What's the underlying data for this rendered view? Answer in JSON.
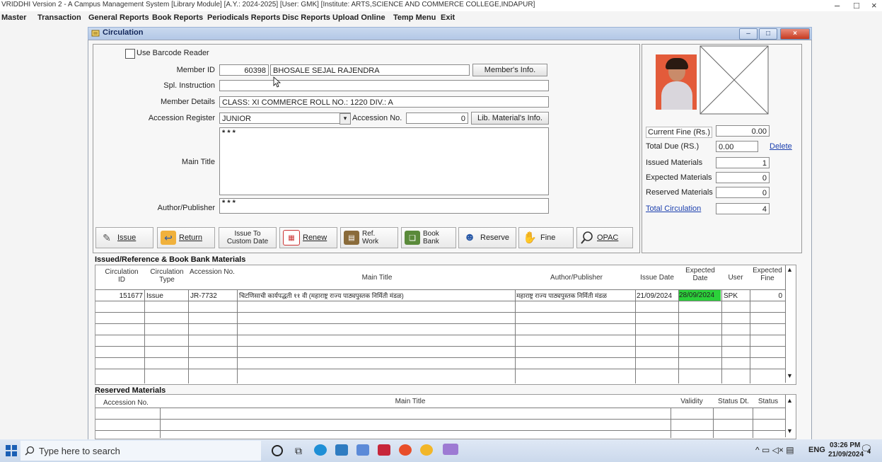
{
  "app": {
    "title": "VRIDDHI Version 2 - A Campus Management System [Library Module] [A.Y.: 2024-2025] [User: GMK] [Institute: ARTS,SCIENCE AND COMMERCE COLLEGE,INDAPUR]",
    "window_controls": [
      "–",
      "□",
      "×"
    ]
  },
  "menu": [
    "Master",
    "Transaction",
    "General Reports",
    "Book Reports",
    "Periodicals Reports",
    "Disc Reports",
    "Upload Online",
    "Temp Menu",
    "Exit"
  ],
  "window": {
    "title": "Circulation",
    "controls": [
      "–",
      "□",
      "×"
    ]
  },
  "form": {
    "barcode_label": "Use Barcode Reader",
    "member_id_label": "Member ID",
    "member_id": "60398",
    "member_name": "BHOSALE SEJAL RAJENDRA",
    "members_info_btn": "Member's Info.",
    "spl_instruction_label": "Spl. Instruction",
    "spl_instruction": "",
    "member_details_label": "Member Details",
    "member_details": "CLASS: XI COMMERCE    ROLL NO.: 1220    DIV.: A",
    "accession_register_label": "Accession Register",
    "accession_register": "JUNIOR",
    "accession_no_label": "Accession No.",
    "accession_no": "0",
    "lib_info_btn": "Lib. Material's Info.",
    "main_title_label": "Main Title",
    "main_title": "* * *",
    "author_label": "Author/Publisher",
    "author": "* * *"
  },
  "stats": {
    "current_fine_label": "Current Fine (Rs.)",
    "current_fine": "0.00",
    "total_due_label": "Total Due (RS.)",
    "total_due": "0.00",
    "delete_link": "Delete",
    "issued_label": "Issued Materials",
    "issued": "1",
    "expected_label": "Expected Materials",
    "expected": "0",
    "reserved_label": "Reserved Materials",
    "reserved": "0",
    "total_circ_label": "Total Circulation",
    "total_circ": "4"
  },
  "toolbar": [
    {
      "label": "Issue",
      "icon": "issue-icon"
    },
    {
      "label": "Return",
      "icon": "return-icon"
    },
    {
      "label": "Issue To Custom Date",
      "icon": "calendar-icon"
    },
    {
      "label": "Renew",
      "icon": "renew-icon"
    },
    {
      "label": "Ref. Work",
      "icon": "reference-icon"
    },
    {
      "label": "Book Bank",
      "icon": "book-bank-icon"
    },
    {
      "label": "Reserve",
      "icon": "reserve-icon"
    },
    {
      "label": "Fine",
      "icon": "fine-icon"
    },
    {
      "label": "OPAC",
      "icon": "search-icon"
    }
  ],
  "issued_section": {
    "title": "Issued/Reference & Book Bank Materials",
    "columns": [
      "Circulation ID",
      "Circulation Type",
      "Accession No.",
      "Main Title",
      "Author/Publisher",
      "Issue Date",
      "Expected Date",
      "User",
      "Expected Fine"
    ],
    "rows": [
      {
        "id": "151677",
        "type": "Issue",
        "acc": "JR-7732",
        "title": "चिटणिसाची कार्यपद्धती ११ वी (महाराष्ट्र राज्य पाठ्यपुस्तक निर्मिती मंडळ)",
        "author": "महाराष्ट्र राज्य पाठ्यपुस्तक निर्मिती मंडळ",
        "issue": "21/09/2024",
        "expected": "28/09/2024",
        "user": "SPK",
        "fine": "0"
      }
    ]
  },
  "reserved_section": {
    "title": "Reserved Materials",
    "columns": [
      "Accession No.",
      "Main Title",
      "Validity",
      "Status Dt.",
      "Status"
    ]
  },
  "taskbar": {
    "search_placeholder": "Type here to search",
    "lang": "ENG",
    "time": "03:26 PM",
    "date": "21/09/2024",
    "notifications": "4"
  },
  "colors": {
    "expected_date_highlight": "#2bd13a",
    "window_header": "#b8cbe8"
  }
}
